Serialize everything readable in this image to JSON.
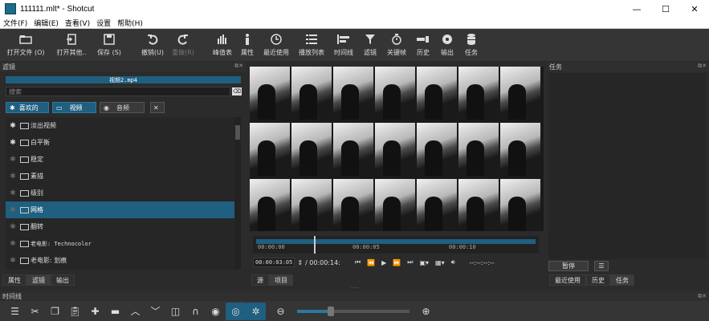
{
  "window": {
    "title": "111111.mlt* - Shotcut",
    "minimize": "—",
    "maximize": "☐",
    "close": "✕"
  },
  "menu": [
    "文件(F)",
    "编辑(E)",
    "查看(V)",
    "设置",
    "帮助(H)"
  ],
  "toolbar": {
    "open_file": "打开文件 (O)",
    "open_other": "打开其他..",
    "save": "保存 (S)",
    "undo": "撤销(U)",
    "redo": "重做(R)",
    "peak_meter": "峰值表",
    "properties": "属性",
    "recent": "最近使用",
    "playlist": "播放列表",
    "timeline": "时间线",
    "filters": "滤镜",
    "keyframes": "关键帧",
    "history": "历史",
    "export": "输出",
    "jobs": "任务"
  },
  "filters_panel": {
    "title": "滤镜",
    "current_file": "视频2.mp4",
    "search_placeholder": "搜索",
    "categories": [
      "喜欢的",
      "视频",
      "音频"
    ],
    "items": [
      {
        "label": "淡出视频",
        "favorite": true,
        "selected": false
      },
      {
        "label": "白平衡",
        "favorite": true,
        "selected": false
      },
      {
        "label": "稳定",
        "favorite": false,
        "selected": false
      },
      {
        "label": "素描",
        "favorite": false,
        "selected": false
      },
      {
        "label": "级别",
        "favorite": false,
        "selected": false
      },
      {
        "label": "网格",
        "favorite": false,
        "selected": true
      },
      {
        "label": "翻转",
        "favorite": false,
        "selected": false
      },
      {
        "label": "老电影: Technocolor",
        "favorite": false,
        "selected": false
      },
      {
        "label": "老电影: 划痕",
        "favorite": false,
        "selected": false
      }
    ],
    "tabs": [
      "属性",
      "滤镜",
      "输出"
    ]
  },
  "player": {
    "ruler_ticks": [
      "00:00:00",
      "00:00:05",
      "00:00:10"
    ],
    "current_time": "00:00:03:05",
    "total_time": "/ 00:00:14:",
    "in_out": "--:--:--:--",
    "tabs": [
      "源",
      "项目"
    ]
  },
  "jobs_panel": {
    "title": "任务",
    "pause_label": "暂停",
    "menu_label": "☰",
    "tabs": [
      "最近使用",
      "历史",
      "任务"
    ]
  },
  "timeline": {
    "title": "时间线",
    "zoom_level": 0.3
  },
  "colors": {
    "accent": "#1f5f7f",
    "background": "#2b2b2b",
    "toolbar": "#353535"
  }
}
